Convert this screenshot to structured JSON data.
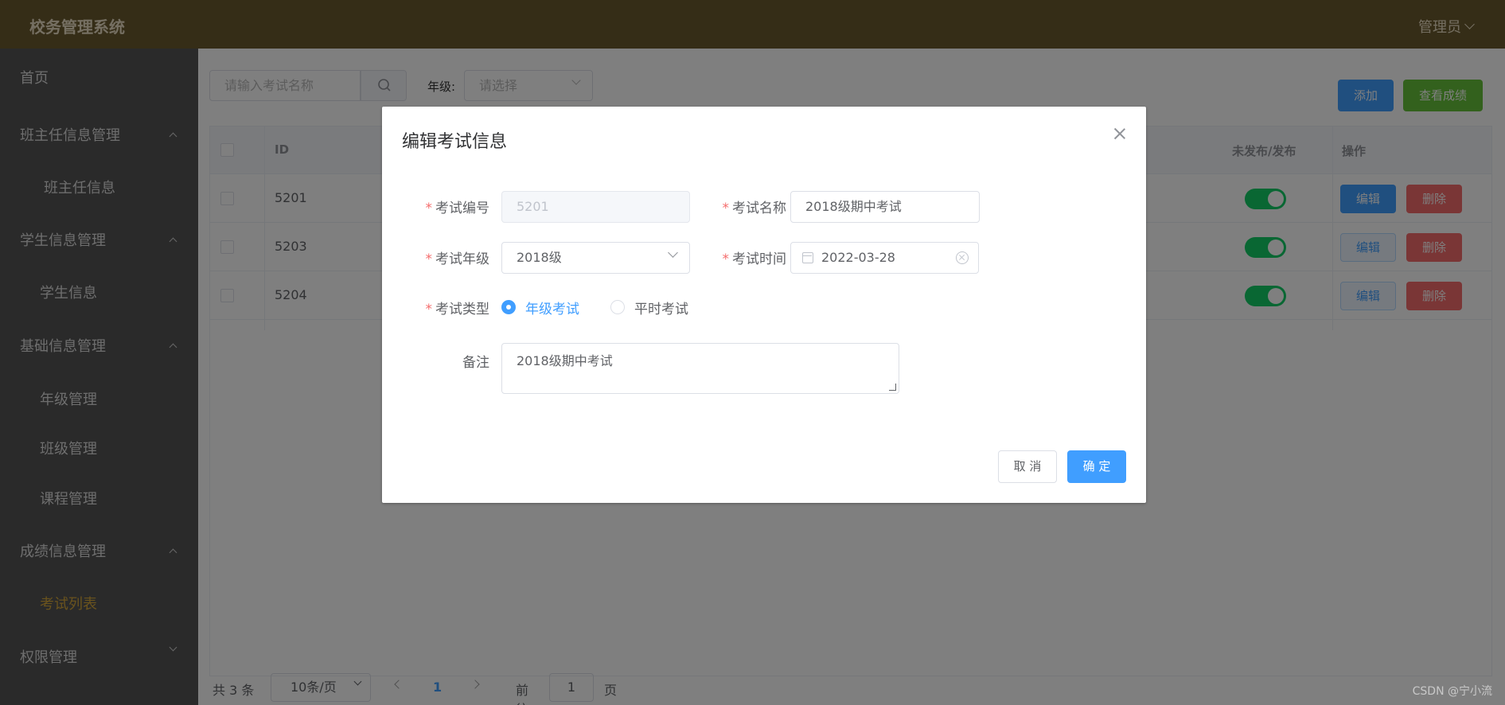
{
  "header": {
    "title": "校务管理系统",
    "user": "管理员"
  },
  "sidebar": {
    "items": [
      {
        "label": "首页",
        "type": "item"
      },
      {
        "label": "班主任信息管理",
        "type": "group"
      },
      {
        "label": "班主任信息",
        "type": "sub"
      },
      {
        "label": "学生信息管理",
        "type": "group"
      },
      {
        "label": "学生信息",
        "type": "sub"
      },
      {
        "label": "基础信息管理",
        "type": "group"
      },
      {
        "label": "年级管理",
        "type": "sub"
      },
      {
        "label": "班级管理",
        "type": "sub"
      },
      {
        "label": "课程管理",
        "type": "sub"
      },
      {
        "label": "成绩信息管理",
        "type": "group"
      },
      {
        "label": "考试列表",
        "type": "sub",
        "active": true
      },
      {
        "label": "权限管理",
        "type": "group"
      }
    ]
  },
  "toolbar": {
    "search_placeholder": "请输入考试名称",
    "grade_label": "年级:",
    "grade_placeholder": "请选择",
    "add_label": "添加",
    "score_label": "查看成绩"
  },
  "table": {
    "headers": {
      "id": "ID",
      "publish": "未发布/发布",
      "actions": "操作"
    },
    "rows": [
      {
        "id": "5201",
        "published": true
      },
      {
        "id": "5203",
        "published": true
      },
      {
        "id": "5204",
        "published": true
      }
    ],
    "edit_label": "编辑",
    "delete_label": "删除"
  },
  "pagination": {
    "total": "共 3 条",
    "page_size": "10条/页",
    "current": "1",
    "goto_label": "前往",
    "goto_value": "1",
    "page_suffix": "页"
  },
  "dialog": {
    "title": "编辑考试信息",
    "fields": {
      "exam_no_label": "考试编号",
      "exam_no_value": "5201",
      "exam_name_label": "考试名称",
      "exam_name_value": "2018级期中考试",
      "exam_grade_label": "考试年级",
      "exam_grade_value": "2018级",
      "exam_time_label": "考试时间",
      "exam_time_value": "2022-03-28",
      "exam_type_label": "考试类型",
      "exam_type_option1": "年级考试",
      "exam_type_option2": "平时考试",
      "remark_label": "备注",
      "remark_value": "2018级期中考试"
    },
    "cancel_label": "取 消",
    "confirm_label": "确 定"
  },
  "watermark": "CSDN @宁小流",
  "colors": {
    "primary": "#409eff",
    "success": "#67c23a",
    "danger": "#f56c6c",
    "header": "#6b5a2f",
    "sidebar": "#545454",
    "active_menu": "#d4a63a"
  }
}
